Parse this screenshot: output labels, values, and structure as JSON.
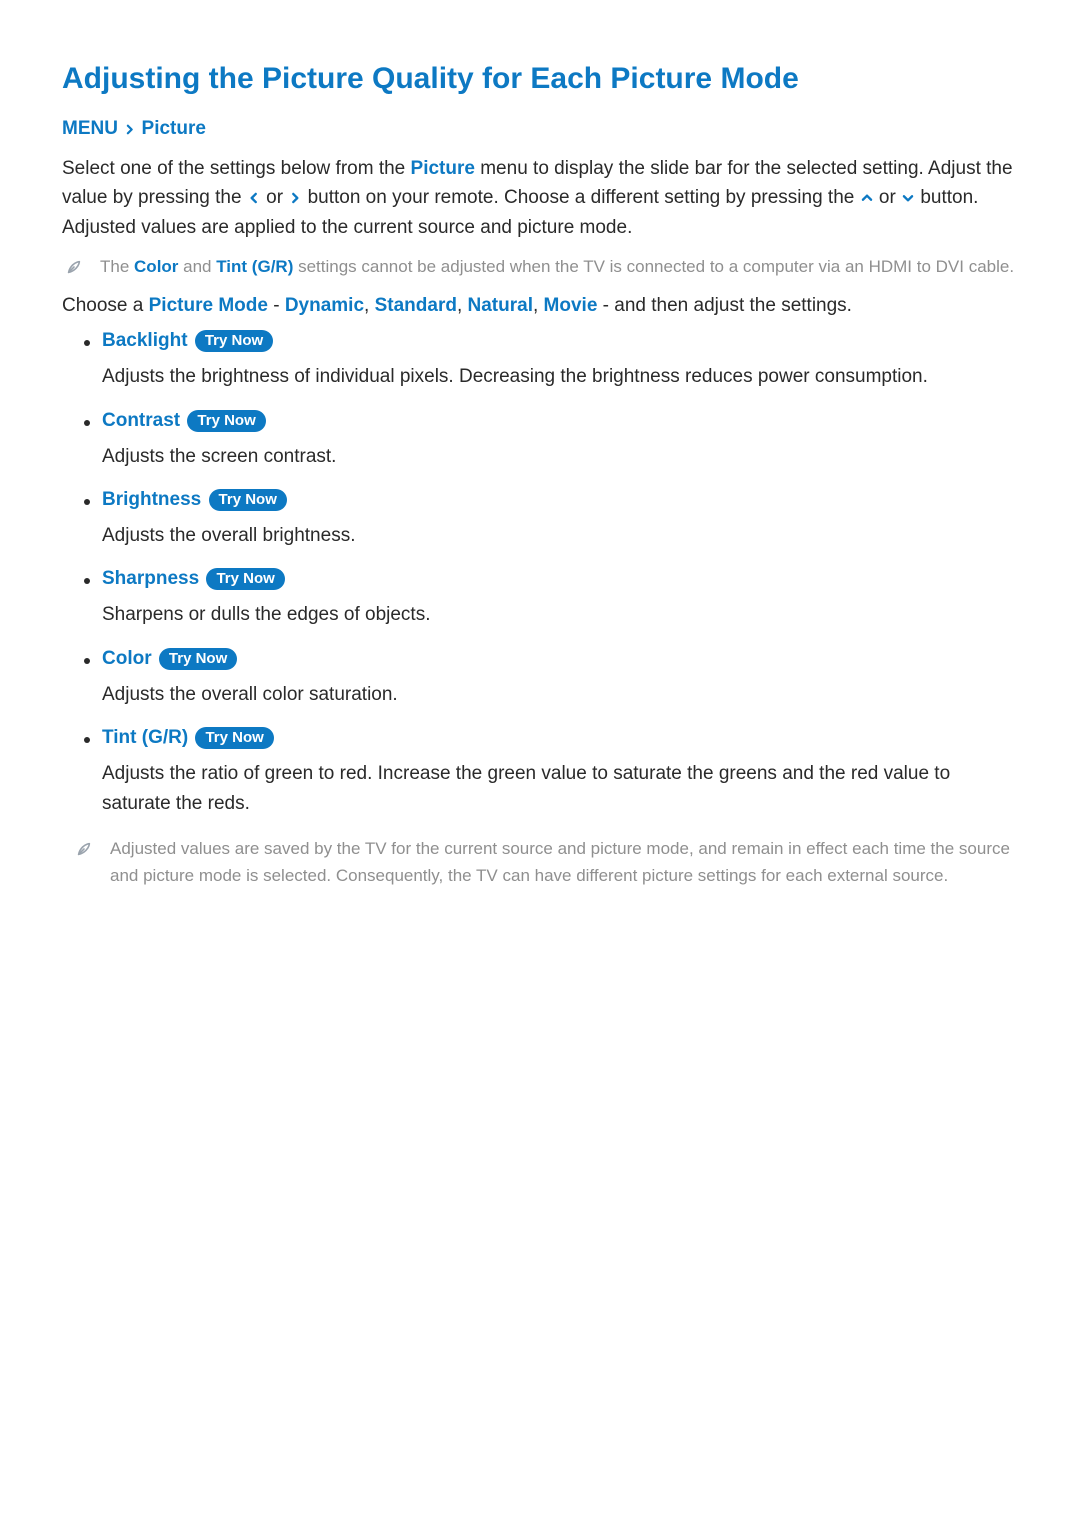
{
  "title": "Adjusting the Picture Quality for Each Picture Mode",
  "breadcrumb": {
    "a": "MENU",
    "b": "Picture"
  },
  "intro": {
    "p1a": "Select one of the settings below from the ",
    "p1_picture": "Picture",
    "p1b": " menu to display the slide bar for the selected setting. Adjust the value by pressing the ",
    "p1c": " or ",
    "p1d": " button on your remote. Choose a different setting by pressing the ",
    "p1e": " or ",
    "p1f": " button. Adjusted values are applied to the current source and picture mode."
  },
  "note1": {
    "a": "The ",
    "color": "Color",
    "b": " and ",
    "tint": "Tint (G/R)",
    "c": " settings cannot be adjusted when the TV is connected to a computer via an HDMI to DVI cable."
  },
  "choose": {
    "a": "Choose a ",
    "pm": "Picture Mode",
    "dash1": " - ",
    "d1": "Dynamic",
    "c1": ", ",
    "d2": "Standard",
    "c2": ", ",
    "d3": "Natural",
    "c3": ", ",
    "d4": "Movie",
    "dash2": " - and then adjust the settings."
  },
  "try_now": "Try Now",
  "items": [
    {
      "name": "Backlight",
      "desc": "Adjusts the brightness of individual pixels. Decreasing the brightness reduces power consumption."
    },
    {
      "name": "Contrast",
      "desc": "Adjusts the screen contrast."
    },
    {
      "name": "Brightness",
      "desc": "Adjusts the overall brightness."
    },
    {
      "name": "Sharpness",
      "desc": "Sharpens or dulls the edges of objects."
    },
    {
      "name": "Color",
      "desc": "Adjusts the overall color saturation."
    },
    {
      "name": "Tint (G/R)",
      "desc": "Adjusts the ratio of green to red. Increase the green value to saturate the greens and the red value to saturate the reds."
    }
  ],
  "note2": "Adjusted values are saved by the TV for the current source and picture mode, and remain in effect each time the source and picture mode is selected. Consequently, the TV can have different picture settings for each external source."
}
